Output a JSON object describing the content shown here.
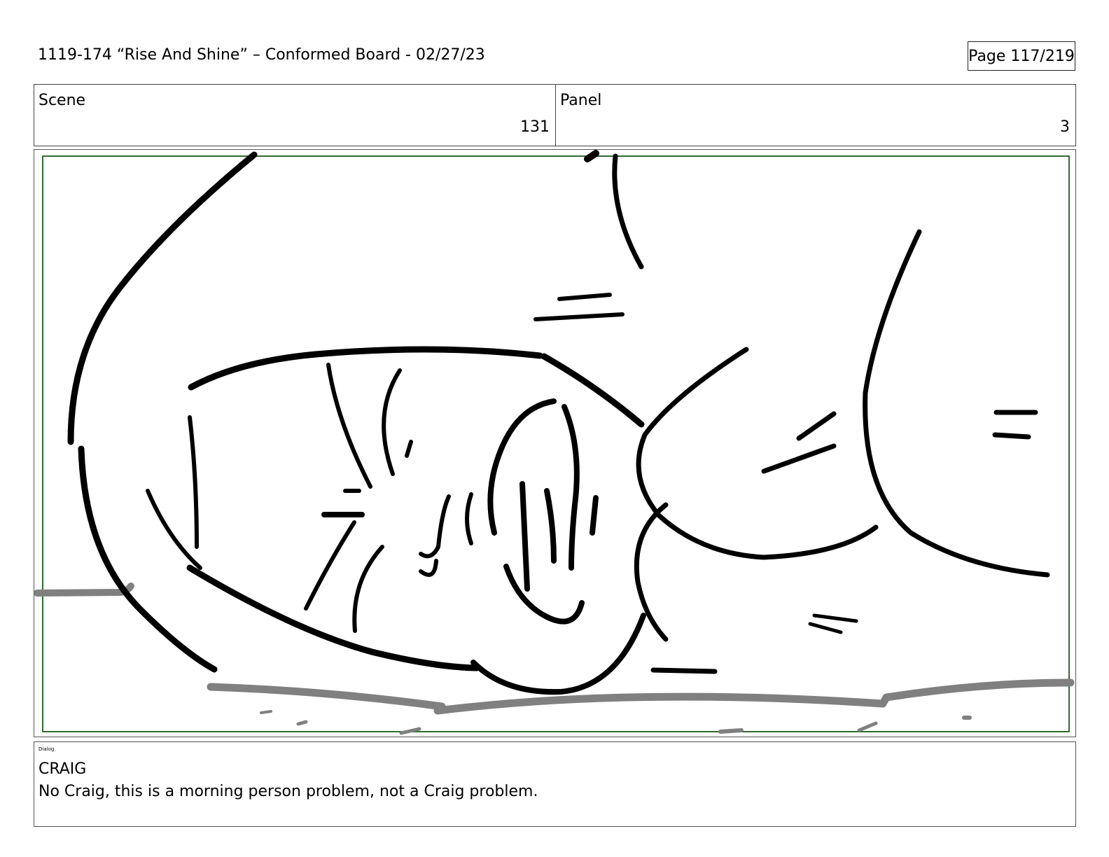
{
  "header": {
    "title": "1119-174 “Rise And Shine” – Conformed Board - 02/27/23",
    "page": "Page 117/219"
  },
  "meta": {
    "scene_label": "Scene",
    "scene_value": "131",
    "panel_label": "Panel",
    "panel_value": "3"
  },
  "frame": {
    "safe_area_color": "#2e6b2e",
    "drawing": "Close-up sketch of a character's face lying sideways with eyes squeezed shut"
  },
  "dialog": {
    "section_label": "Dialog",
    "speaker": "CRAIG",
    "text": "No Craig, this is a morning person problem, not a Craig problem."
  }
}
